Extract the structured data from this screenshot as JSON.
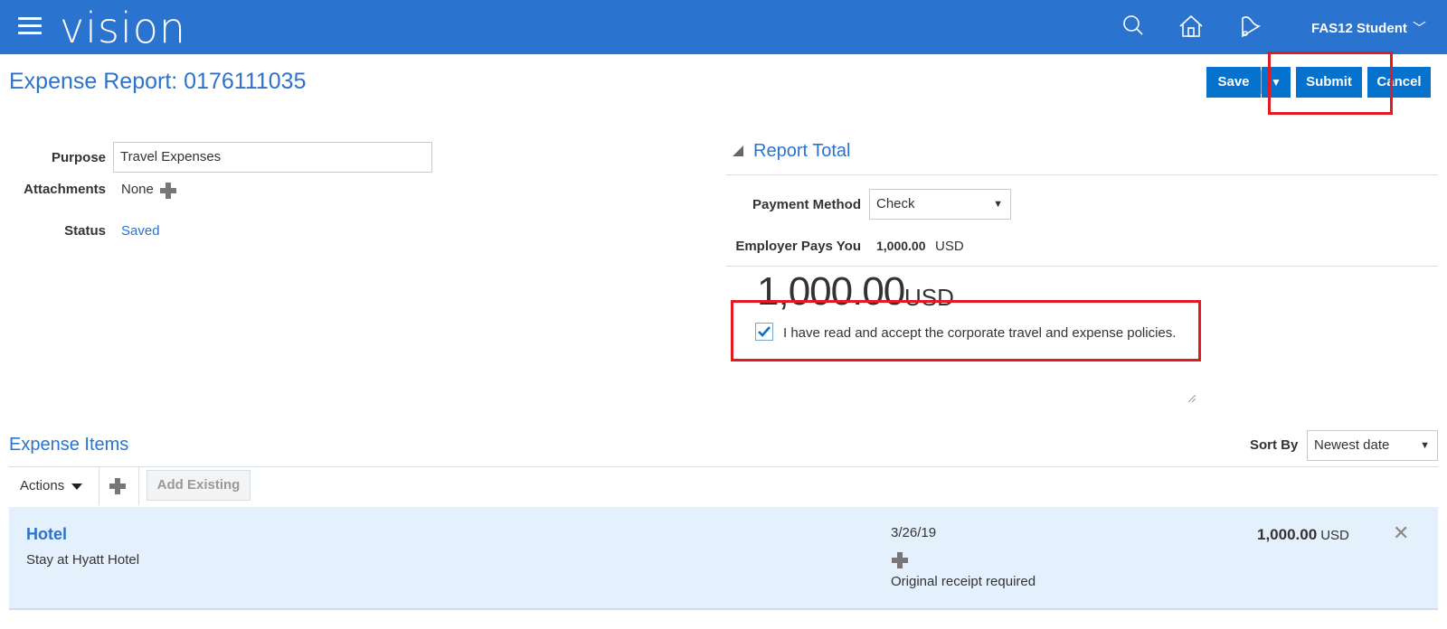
{
  "header": {
    "logo": "vision",
    "user_name": "FAS12 Student",
    "user_chevron": "﹀",
    "icons": [
      "menu-icon",
      "search-icon",
      "home-icon",
      "notifications-icon"
    ],
    "bar_color": "#2a73cf"
  },
  "page": {
    "title": "Expense Report: 0176111035",
    "buttons": {
      "save": "Save",
      "save_dropdown": "▼",
      "submit": "Submit",
      "cancel": "Cancel"
    }
  },
  "form": {
    "purpose_label": "Purpose",
    "purpose_value": "Travel Expenses",
    "attachments_label": "Attachments",
    "attachments_value": "None",
    "status_label": "Status",
    "status_value": "Saved"
  },
  "report_total": {
    "section_title": "Report Total",
    "payment_method_label": "Payment Method",
    "payment_method_value": "Check",
    "employer_pays_label": "Employer Pays You",
    "employer_pays_amount": "1,000.00",
    "employer_pays_currency": "USD",
    "total_amount": "1,000.00",
    "total_currency": "USD",
    "policy_text": "I have read and accept the corporate travel and expense policies.",
    "policy_checked": true
  },
  "expense_items": {
    "section_title": "Expense Items",
    "sort_label": "Sort By",
    "sort_value": "Newest date",
    "actions_label": "Actions",
    "add_existing_label": "Add Existing",
    "items": [
      {
        "name": "Hotel",
        "description": "Stay at Hyatt Hotel",
        "date": "3/26/19",
        "receipt_note": "Original receipt required",
        "amount": "1,000.00",
        "currency": "USD"
      }
    ]
  },
  "colors": {
    "accent": "#2a73cf",
    "button": "#0572ce",
    "highlight": "#e21b22",
    "row_bg": "#e4f0fc"
  }
}
